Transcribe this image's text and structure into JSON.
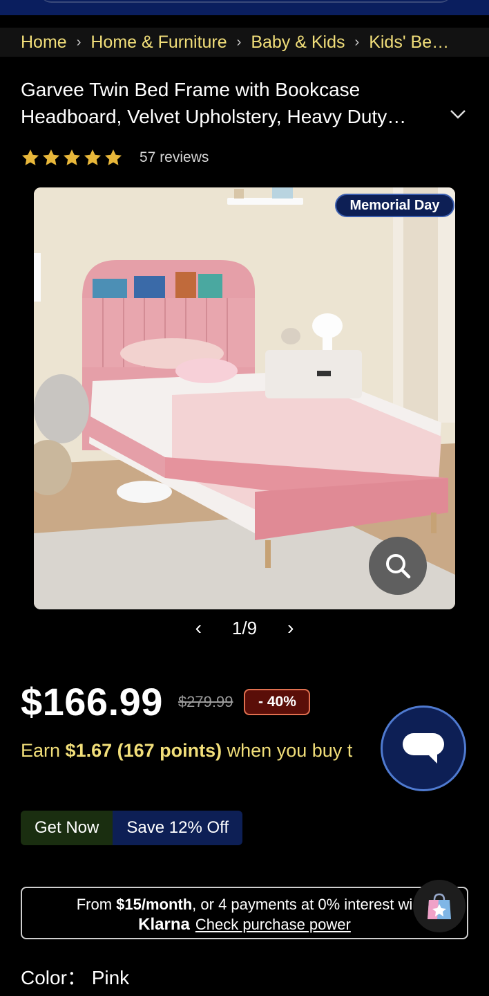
{
  "breadcrumb": [
    "Home",
    "Home & Furniture",
    "Baby & Kids",
    "Kids' Be…"
  ],
  "product": {
    "title_line1": "Garvee Twin Bed Frame with Bookcase",
    "title_line2": "Headboard, Velvet Upholstery, Heavy Duty…",
    "rating_stars": 5,
    "reviews": "57 reviews",
    "badge": "Memorial Day",
    "image_counter": "1/9",
    "price": "$166.99",
    "old_price": "$279.99",
    "discount": "- 40%",
    "earn_prefix": "Earn ",
    "earn_amount": "$1.67 (167 points)",
    "earn_suffix": " when you buy t",
    "getnow_label": "Get Now",
    "save_label": "Save 12% Off",
    "klarna_line1_a": "From ",
    "klarna_line1_b": "$15/month",
    "klarna_line1_c": ", or 4 payments at 0% interest wi",
    "klarna_brand": "Klarna",
    "klarna_link": "Check purchase power",
    "color_label": "Color：",
    "color_value": "Pink"
  },
  "colors": {
    "accent_yellow": "#f2df7a",
    "star": "#e8b73a",
    "navy": "#0d1f55",
    "discount_bg": "#5a0e08"
  }
}
